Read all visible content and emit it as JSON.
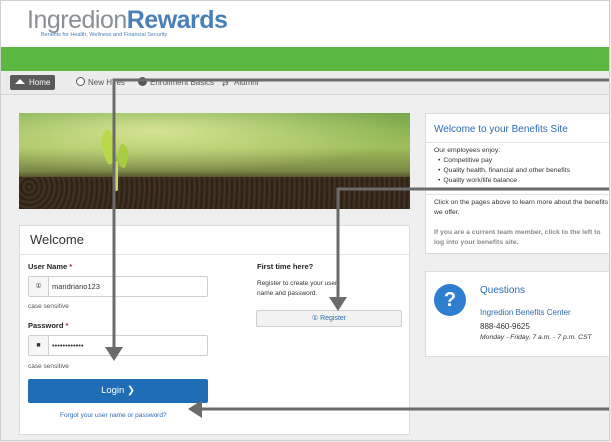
{
  "logo": {
    "brand_part1": "Ingredion",
    "brand_part2": "Rewards",
    "tagline": "Benefits for Health, Wellness and Financial Security"
  },
  "nav": {
    "items": [
      {
        "label": "Home"
      },
      {
        "label": "New Hires"
      },
      {
        "label": "Enrollment Basics"
      },
      {
        "label": "Alumni"
      }
    ]
  },
  "login": {
    "title": "Welcome",
    "username_label": "User Name",
    "username_value": "mandriano123",
    "case_sensitive": "case sensitive",
    "password_label": "Password",
    "password_value": "••••••••••••",
    "login_button": "Login",
    "forgot_link": "Forgot your user name or password?",
    "first_time_title": "First time here?",
    "first_time_text": "Register to create your user name and password.",
    "register_button": "Register"
  },
  "benefits": {
    "title": "Welcome to your Benefits Site",
    "intro": "Our employees enjoy:",
    "list": [
      "Competitive pay",
      "Quality health, financial and other benefits",
      "Quality work/life balance"
    ],
    "click_text": "Click on the pages above to learn more about the benefits we offer.",
    "current_member_text": "If you are a current team member, click to the left to log into your benefits site."
  },
  "questions": {
    "title": "Questions",
    "center_name": "Ingredion Benefits Center",
    "phone": "888-460-9625",
    "hours": "Monday - Friday, 7 a.m. - 7 p.m. CST"
  },
  "colors": {
    "green_bar": "#5db843",
    "primary_blue": "#1f6db5",
    "link_blue": "#2a6bb0",
    "arrow_gray": "#6b6b6b"
  }
}
